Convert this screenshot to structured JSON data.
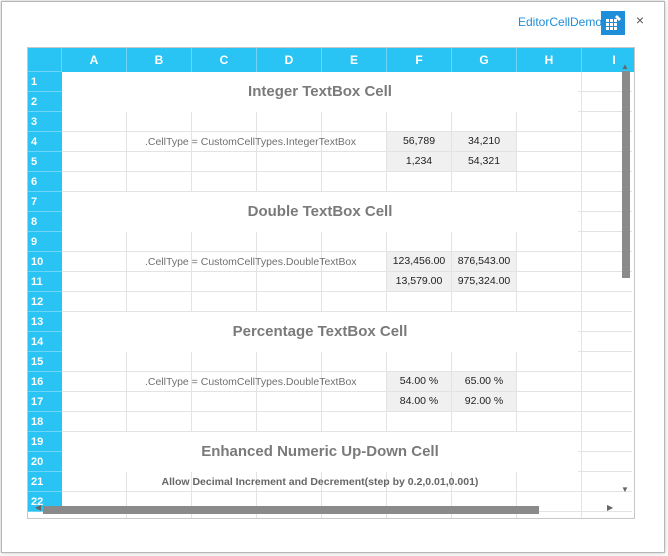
{
  "window": {
    "title": "EditorCellDemo",
    "close_glyph": "×",
    "app_icon": "grid-edit-icon"
  },
  "columns": [
    "A",
    "B",
    "C",
    "D",
    "E",
    "F",
    "G",
    "H",
    "I"
  ],
  "rows": [
    "1",
    "2",
    "3",
    "4",
    "5",
    "6",
    "7",
    "8",
    "9",
    "10",
    "11",
    "12",
    "13",
    "14",
    "15",
    "16",
    "17",
    "18",
    "19",
    "20",
    "21",
    "22"
  ],
  "sections": {
    "integer": {
      "title": "Integer TextBox Cell",
      "label": ".CellType = CustomCellTypes.IntegerTextBox",
      "values": [
        [
          "56,789",
          "34,210"
        ],
        [
          "1,234",
          "54,321"
        ]
      ]
    },
    "double": {
      "title": "Double TextBox Cell",
      "label": ".CellType = CustomCellTypes.DoubleTextBox",
      "values": [
        [
          "123,456.00",
          "876,543.00"
        ],
        [
          "13,579.00",
          "975,324.00"
        ]
      ]
    },
    "percentage": {
      "title": "Percentage TextBox Cell",
      "label": ".CellType = CustomCellTypes.DoubleTextBox",
      "values": [
        [
          "54.00 %",
          "65.00 %"
        ],
        [
          "84.00 %",
          "92.00 %"
        ]
      ]
    },
    "updown": {
      "title": "Enhanced Numeric Up-Down Cell",
      "subtitle": "Allow Decimal Increment and Decrement(step by 0.2,0.01,0.001)"
    }
  },
  "colors": {
    "header": "#29c4f3",
    "accent": "#1e8ed8",
    "value_bg": "#f0f0f0"
  }
}
